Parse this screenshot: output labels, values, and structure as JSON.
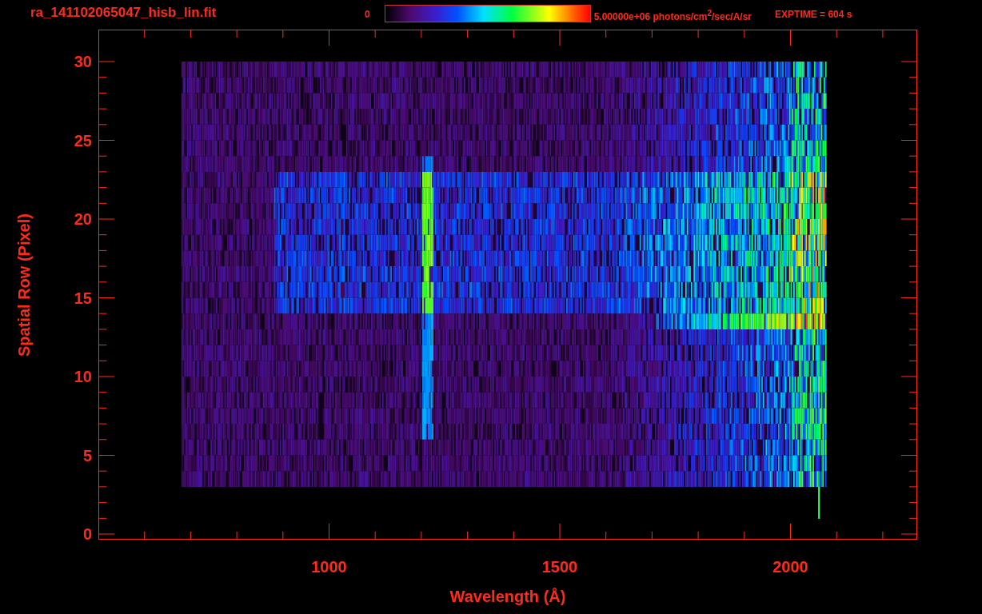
{
  "title": "ra_141102065047_hisb_lin.fit",
  "colorbar": {
    "min_label": "0",
    "max_label": "5.00000e+06 photons/cm$^{2}$/sec/A/sr"
  },
  "exposure": "EXPTIME = 604 s",
  "y_axis": {
    "title": "Spatial Row (Pixel)",
    "ticks": [
      "30",
      "25",
      "20",
      "15",
      "10",
      "5",
      "0"
    ]
  },
  "x_axis": {
    "title": "Wavelength (Å)",
    "ticks": [
      "1000",
      "1500",
      "2000"
    ]
  }
}
